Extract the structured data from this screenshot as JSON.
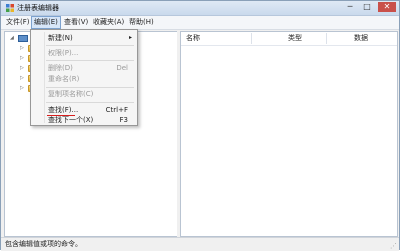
{
  "window": {
    "title": "注册表编辑器",
    "minimize": "─",
    "maximize": "□",
    "close": "✕"
  },
  "menubar": [
    {
      "label": "文件(F)"
    },
    {
      "label": "编辑(E)"
    },
    {
      "label": "查看(V)"
    },
    {
      "label": "收藏夹(A)"
    },
    {
      "label": "帮助(H)"
    }
  ],
  "edit_menu": {
    "items": [
      {
        "label": "新建(N)",
        "shortcut": "▸",
        "enabled": true
      },
      {
        "label": "权限(P)...",
        "shortcut": "",
        "enabled": false
      },
      {
        "label": "删除(D)",
        "shortcut": "Del",
        "enabled": false
      },
      {
        "label": "重命名(R)",
        "shortcut": "",
        "enabled": false
      },
      {
        "label": "复制项名称(C)",
        "shortcut": "",
        "enabled": false
      },
      {
        "label": "查找(F)...",
        "shortcut": "Ctrl+F",
        "enabled": true
      },
      {
        "label": "查找下一个(X)",
        "shortcut": "F3",
        "enabled": true
      }
    ]
  },
  "tree": {
    "root_expander": "◢",
    "child_expander": "▷"
  },
  "list_columns": [
    {
      "label": "名称"
    },
    {
      "label": "类型"
    },
    {
      "label": "数据"
    }
  ],
  "statusbar": {
    "text": "包含编辑值或项的命令。",
    "grip": "⋰"
  },
  "colors": {
    "title_bar": "#c9d9ec",
    "menu_highlight": "#d7e6f8",
    "annotation_red": "#d81e1e",
    "folder": "#e3b63a"
  },
  "icons": {
    "app": "registry-editor-icon",
    "root": "computer-icon",
    "child": "folder-icon"
  }
}
